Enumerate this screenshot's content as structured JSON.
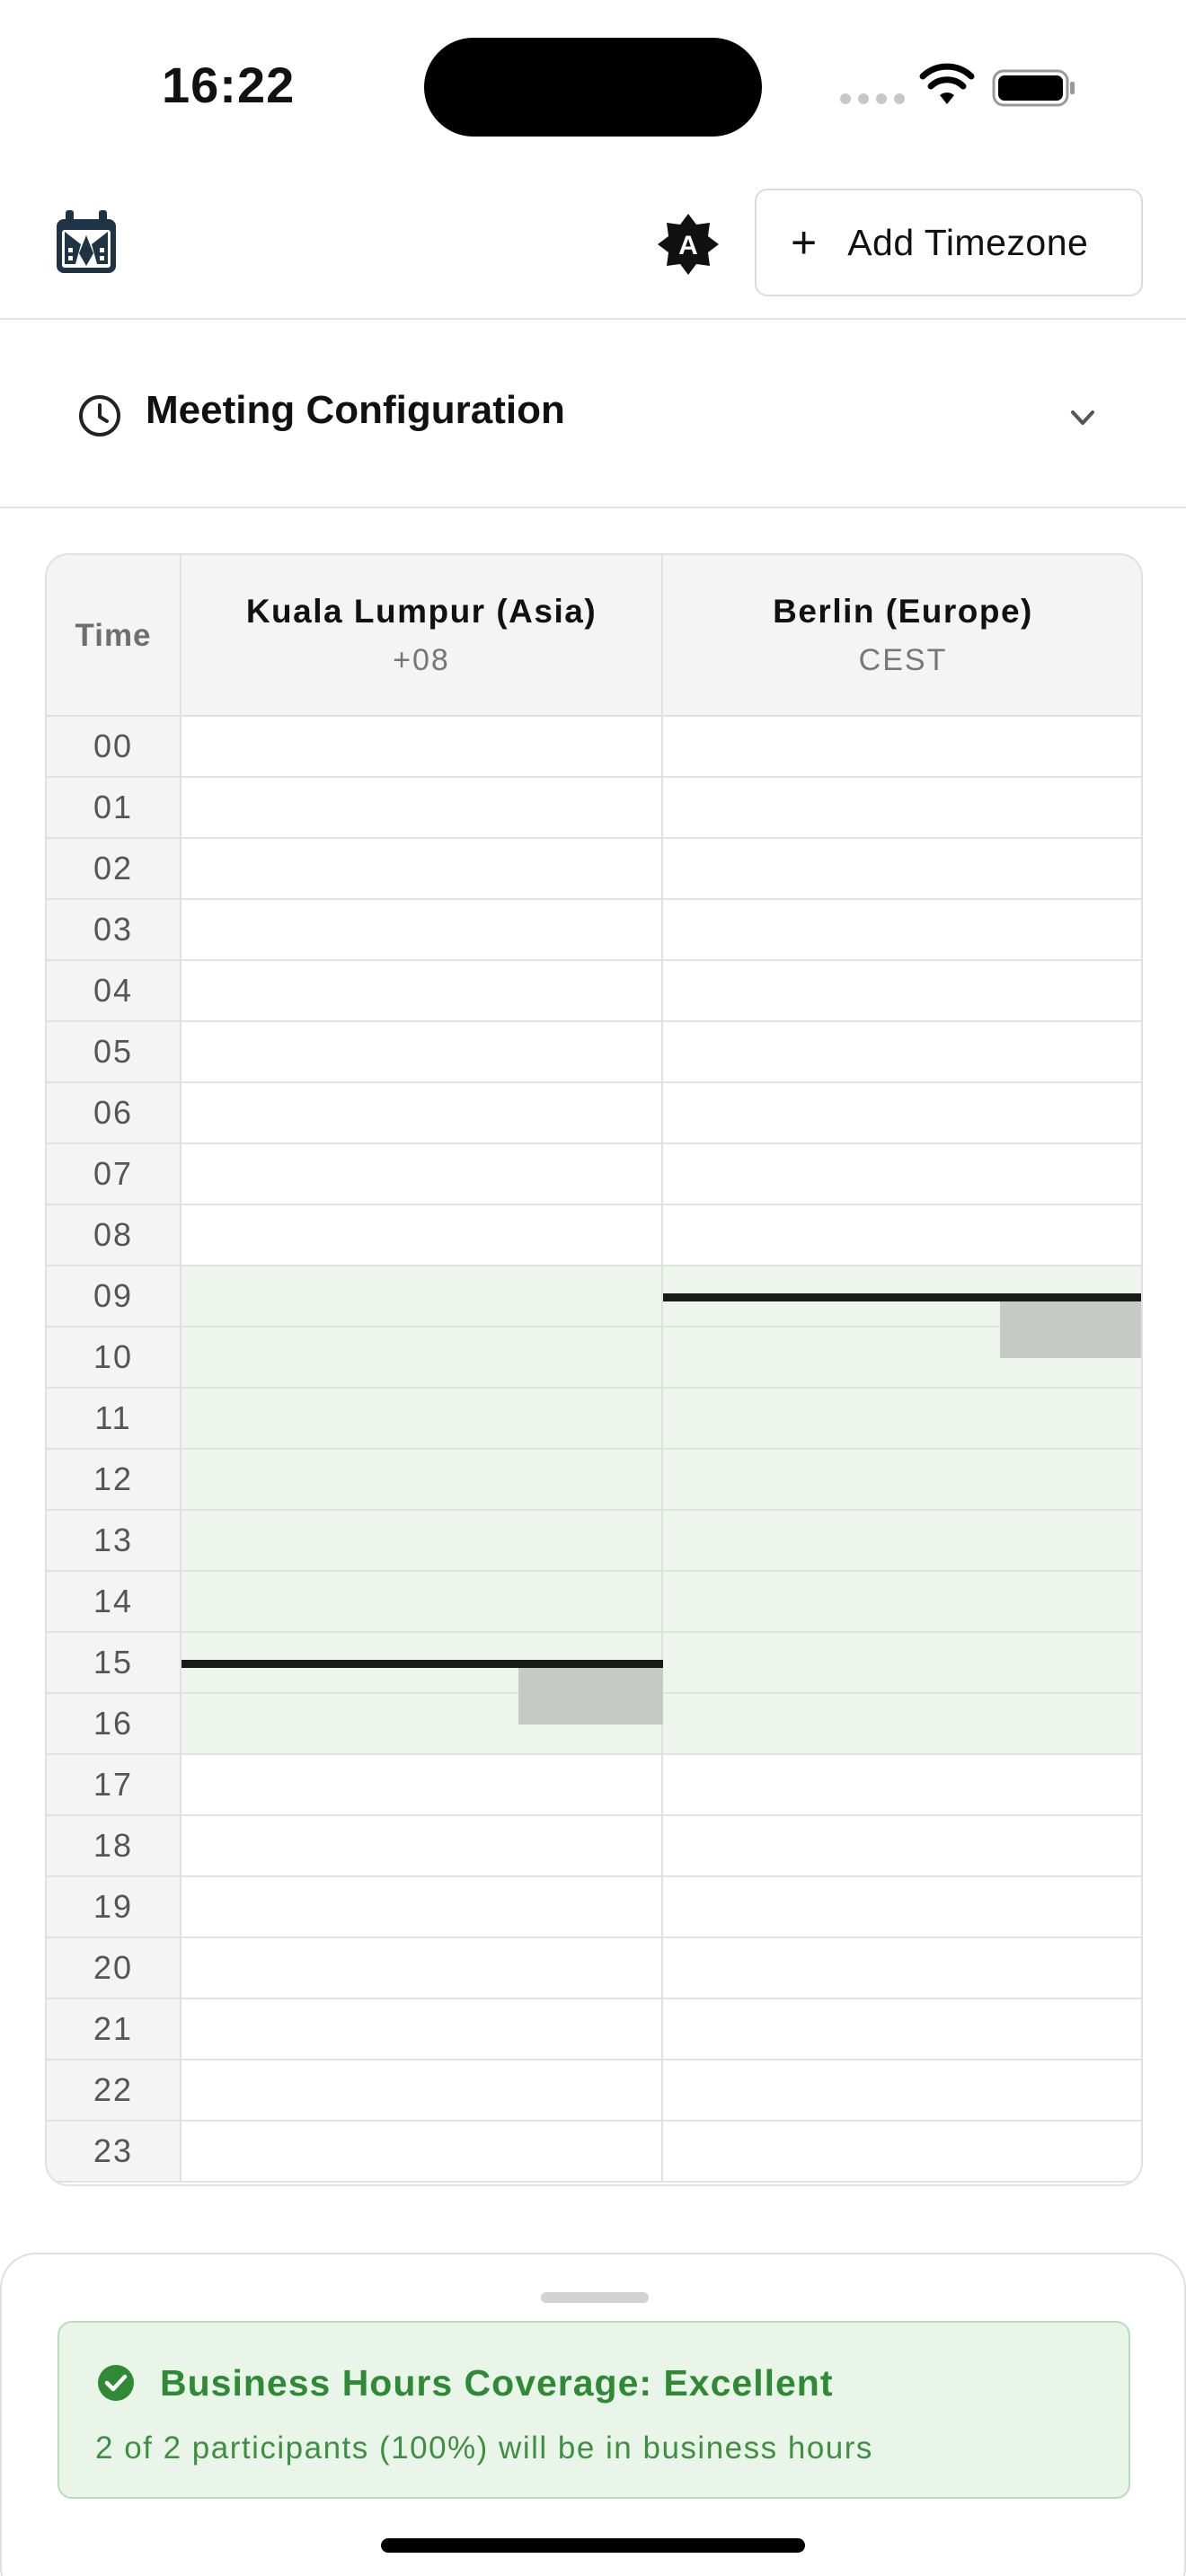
{
  "status_bar": {
    "time": "16:22"
  },
  "header": {
    "logo_icon": "calendar-globe-icon",
    "theme_badge": "A",
    "add_timezone_icon": "plus-icon",
    "add_timezone_label": "Add Timezone"
  },
  "meeting_config": {
    "icon": "clock-icon",
    "title": "Meeting Configuration",
    "expand_icon": "chevron-down-icon"
  },
  "schedule": {
    "time_header": "Time",
    "hours": [
      "00",
      "01",
      "02",
      "03",
      "04",
      "05",
      "06",
      "07",
      "08",
      "09",
      "10",
      "11",
      "12",
      "13",
      "14",
      "15",
      "16",
      "17",
      "18",
      "19",
      "20",
      "21",
      "22",
      "23"
    ],
    "business_hours_rows": [
      9,
      16
    ],
    "timezones": [
      {
        "name": "Kuala Lumpur (Asia)",
        "abbr": "+08",
        "meeting_start_row": 15.5,
        "meeting_block_rows": [
          15.5,
          16.5
        ]
      },
      {
        "name": "Berlin (Europe)",
        "abbr": "CEST",
        "meeting_start_row": 9.5,
        "meeting_block_rows": [
          9.5,
          10.5
        ]
      }
    ]
  },
  "coverage": {
    "icon": "check-circle-icon",
    "title": "Business Hours Coverage: Excellent",
    "detail": "2 of 2 participants (100%) will be in business hours"
  },
  "colors": {
    "business_hours_fill": "#edf5ec",
    "meeting_line": "#1a1a1a",
    "meeting_block": "#c6c9c6",
    "success_text": "#2f8a35",
    "success_bg": "#eaf5ea"
  }
}
